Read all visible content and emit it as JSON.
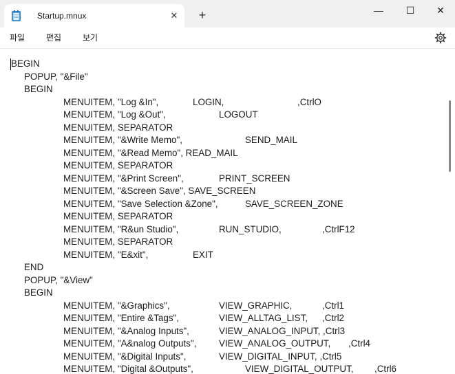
{
  "tab": {
    "title": "Startup.mnux",
    "close_glyph": "✕",
    "icon": "notepad-icon"
  },
  "new_tab_glyph": "+",
  "window": {
    "minimize_glyph": "—",
    "maximize_glyph": "☐",
    "close_glyph": "✕"
  },
  "menu": {
    "file": "파일",
    "edit": "편집",
    "view": "보기",
    "settings_icon": "gear-icon"
  },
  "lines": [
    [
      "BEGIN"
    ],
    [
      "POPUP, \"&File\""
    ],
    [
      "BEGIN"
    ],
    [
      "MENUITEM, \"Log &In\",",
      "LOGIN,",
      ",CtrlO"
    ],
    [
      "MENUITEM, \"Log &Out\",",
      "LOGOUT"
    ],
    [
      "MENUITEM, SEPARATOR"
    ],
    [
      "MENUITEM, \"&Write Memo\",",
      "SEND_MAIL"
    ],
    [
      "MENUITEM, \"&Read Memo\", READ_MAIL"
    ],
    [
      "MENUITEM, SEPARATOR"
    ],
    [
      "MENUITEM, \"&Print Screen\",",
      "PRINT_SCREEN"
    ],
    [
      "MENUITEM, \"&Screen Save\", SAVE_SCREEN"
    ],
    [
      "MENUITEM, \"Save Selection &Zone\",",
      "SAVE_SCREEN_ZONE"
    ],
    [
      "MENUITEM, SEPARATOR"
    ],
    [
      "MENUITEM, \"R&un Studio\",",
      "RUN_STUDIO,",
      ",CtrlF12"
    ],
    [
      "MENUITEM, SEPARATOR"
    ],
    [
      "MENUITEM, \"E&xit\",",
      "EXIT"
    ],
    [
      "END"
    ],
    [
      "POPUP, \"&View\""
    ],
    [
      "BEGIN"
    ],
    [
      "MENUITEM, \"&Graphics\",",
      "VIEW_GRAPHIC,",
      ",Ctrl1"
    ],
    [
      "MENUITEM, \"Entire &Tags\",",
      "VIEW_ALLTAG_LIST,",
      ",Ctrl2"
    ],
    [
      "MENUITEM, \"&Analog Inputs\",",
      "VIEW_ANALOG_INPUT, ,Ctrl3"
    ],
    [
      "MENUITEM, \"A&nalog Outputs\",",
      "VIEW_ANALOG_OUTPUT,",
      ",Ctrl4"
    ],
    [
      "MENUITEM, \"&Digital Inputs\",",
      "VIEW_DIGITAL_INPUT, ,Ctrl5"
    ],
    [
      "MENUITEM, \"Digital &Outputs\",",
      "VIEW_DIGITAL_OUTPUT,",
      ",Ctrl6"
    ]
  ]
}
